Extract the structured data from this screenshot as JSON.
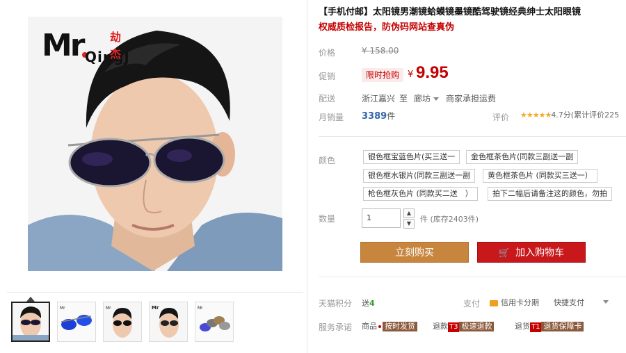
{
  "gallery": {
    "logo": {
      "mr": "Mr",
      "qingj": "QingJ",
      "cn": "劫杰"
    },
    "thumbnails": [
      "thumb-1",
      "thumb-2",
      "thumb-3",
      "thumb-4",
      "thumb-5"
    ]
  },
  "product": {
    "title": "【手机付邮】太阳镜男潮镜蛤蟆镜墨镜酷驾驶镜经典绅士太阳眼镜",
    "subtitle": "权威质检报告，防伪码网站查真伪"
  },
  "price": {
    "label": "价格",
    "original": "¥ 158.00"
  },
  "promo": {
    "label": "促销",
    "badge": "限时抢购",
    "currency": "¥",
    "price": "9.95"
  },
  "shipping": {
    "label": "配送",
    "from": "浙江嘉兴",
    "to_word": "至",
    "dest": "廊坊",
    "fee": "商家承担运费"
  },
  "sales": {
    "label": "月销量",
    "count": "3389",
    "unit": "件",
    "rating_label": "评价",
    "stars": "★★★★★",
    "rating_text": "4.7分(累计评价225"
  },
  "color": {
    "label": "颜色",
    "options": [
      "银色框宝蓝色片(买三送一",
      "金色框茶色片(同款三副送一副",
      "银色框水银片(同款三副送一副",
      "黄色框茶色片 (同款买三送一）",
      "枪色框灰色片 (同款买二送　）",
      "拍下二幅后请备注这的颜色，勿拍"
    ]
  },
  "quantity": {
    "label": "数量",
    "value": "1",
    "up": "▲",
    "down": "▼",
    "stock": "件 (库存2403件)"
  },
  "buttons": {
    "buy": "立刻购买",
    "cart": "加入购物车",
    "cart_icon": "🛒"
  },
  "tmall": {
    "label": "天猫积分",
    "give": "送",
    "points": "4",
    "pay_label": "支付",
    "credit": "信用卡分期",
    "quick_pay": "快捷支付"
  },
  "service": {
    "label": "服务承诺",
    "goods": "商品",
    "fast": "按时发货",
    "return1": "退款",
    "t3": "T3",
    "t3text": "极速退款",
    "return2": "退货",
    "t1": "T1",
    "t1text": "退货保障卡"
  }
}
